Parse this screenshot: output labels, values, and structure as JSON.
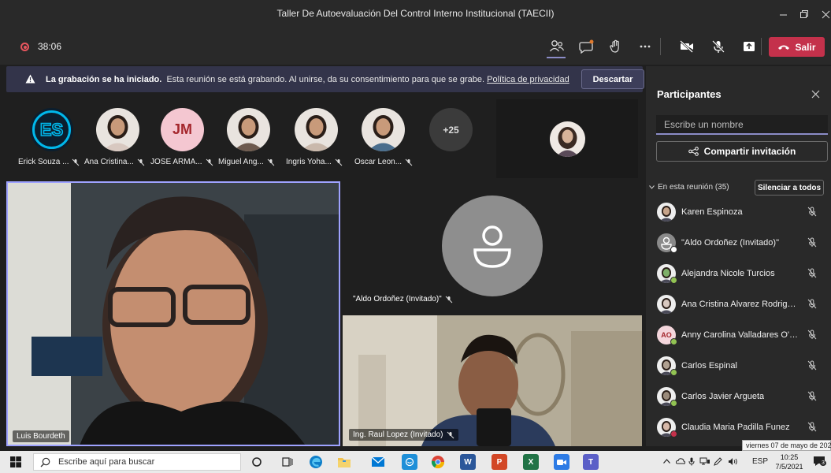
{
  "window": {
    "title": "Taller De Autoevaluación Del Control Interno Institucional (TAECII)",
    "minimize_icon": "minimize-icon",
    "maximize_icon": "maximize-icon",
    "close_icon": "close-icon"
  },
  "toolbar": {
    "timer": "38:06",
    "leave_label": "Salir",
    "icons": [
      "people-icon",
      "chat-icon",
      "raise-hand-icon",
      "more-icon",
      "camera-off-icon",
      "mic-off-icon",
      "share-screen-icon",
      "phone-icon"
    ]
  },
  "banner": {
    "bold": "La grabación se ha iniciado.",
    "message": "Esta reunión se está grabando. Al unirse, da su consentimiento para que se grabe.",
    "link": "Política de privacidad",
    "dismiss_label": "Descartar"
  },
  "strip": {
    "people": [
      {
        "name": "Erick Souza ...",
        "avatar": "ES",
        "color": "#00b7eb"
      },
      {
        "name": "Ana Cristina...",
        "avatar": "",
        "color": "#d8c8c0"
      },
      {
        "name": "JOSE ARMA...",
        "avatar": "JM",
        "color": "#f4c7d1"
      },
      {
        "name": "Miguel Ang...",
        "avatar": "",
        "color": "#6d5a4e"
      },
      {
        "name": "Ingris Yoha...",
        "avatar": "",
        "color": "#c9b8ab"
      },
      {
        "name": "Oscar Leon...",
        "avatar": "",
        "color": "#4a6d8c"
      }
    ],
    "overflow": "+25"
  },
  "tiles": {
    "main_name": "Luis Bourdeth",
    "aldo_name": "\"Aldo Ordoñez (Invitado)\"",
    "raul_name": "Ing. Raul Lopez (Invitado)"
  },
  "panel": {
    "title": "Participantes",
    "search_placeholder": "Escribe un nombre",
    "share_label": "Compartir invitación",
    "section_label": "En esta reunión (35)",
    "mute_all_label": "Silenciar a todos",
    "participants": [
      {
        "name": "Karen Espinoza",
        "initials": "",
        "avatar_color": "#c7a48a",
        "status": ""
      },
      {
        "name": "\"Aldo Ordoñez (Invitado)\"",
        "initials": "",
        "avatar_color": "#8a8a8a",
        "status": "#ffffff"
      },
      {
        "name": "Alejandra Nicole Turcios",
        "initials": "",
        "avatar_color": "#7fb069",
        "status": "#92c353"
      },
      {
        "name": "Ana Cristina Alvarez Rodriguez",
        "initials": "",
        "avatar_color": "#d8c8c0",
        "status": ""
      },
      {
        "name": "Anny Carolina Valladares O'co...",
        "initials": "AO",
        "avatar_color": "#f4d6dc",
        "status": "#92c353"
      },
      {
        "name": "Carlos Espinal",
        "initials": "",
        "avatar_color": "#b0a090",
        "status": "#92c353"
      },
      {
        "name": "Carlos Javier Argueta",
        "initials": "",
        "avatar_color": "#9a8a7a",
        "status": "#92c353"
      },
      {
        "name": "Claudia Maria Padilla Funez",
        "initials": "",
        "avatar_color": "#d6b8a8",
        "status": "#c4314b"
      }
    ]
  },
  "tooltip": "viernes 07 de mayo de 2021",
  "taskbar": {
    "search_placeholder": "Escribe aquí para buscar",
    "lang": "ESP",
    "time": "10:25",
    "date": "7/5/2021",
    "notifications": "3"
  }
}
